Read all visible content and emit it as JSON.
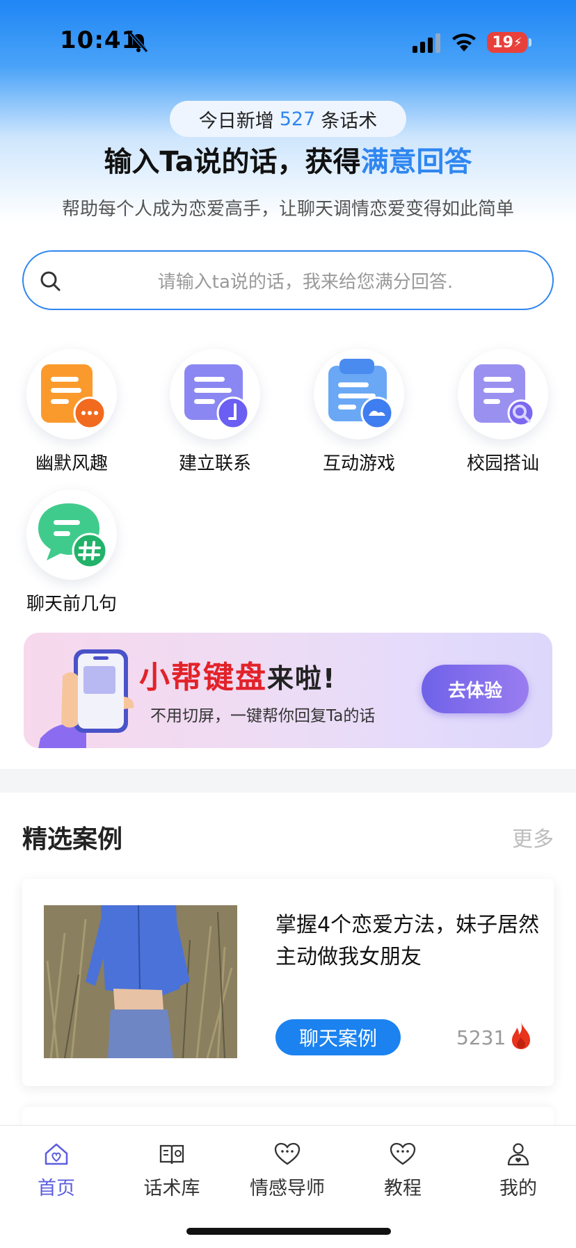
{
  "status_bar": {
    "time": "10:41",
    "battery": "19"
  },
  "header": {
    "daily_prefix": "今日新增",
    "daily_count": "527",
    "daily_suffix": "条话术",
    "title_part1": "输入Ta说的话，获得",
    "title_highlight": "满意回答",
    "subtitle": "帮助每个人成为恋爱高手，让聊天调情恋爱变得如此简单"
  },
  "search": {
    "placeholder": "请输入ta说的话，我来给您满分回答."
  },
  "categories": [
    {
      "label": "幽默风趣",
      "icon": "humor-icon"
    },
    {
      "label": "建立联系",
      "icon": "connect-icon"
    },
    {
      "label": "互动游戏",
      "icon": "game-icon"
    },
    {
      "label": "校园搭讪",
      "icon": "campus-icon"
    },
    {
      "label": "聊天前几句",
      "icon": "chat-opener-icon"
    }
  ],
  "banner": {
    "title_red": "小帮键盘",
    "title_dark": "来啦!",
    "subtitle": "不用切屏，一键帮你回复Ta的话",
    "button": "去体验"
  },
  "featured": {
    "title": "精选案例",
    "more": "更多",
    "cases": [
      {
        "title": "掌握4个恋爱方法，妹子居然主动做我女朋友",
        "tag": "聊天案例",
        "views": "5231"
      }
    ]
  },
  "tabbar": {
    "items": [
      {
        "label": "首页",
        "active": true
      },
      {
        "label": "话术库",
        "active": false
      },
      {
        "label": "情感导师",
        "active": false
      },
      {
        "label": "教程",
        "active": false
      },
      {
        "label": "我的",
        "active": false
      }
    ]
  },
  "colors": {
    "accent": "#2f86f0",
    "tab_active": "#5c5ce0",
    "banner_red": "#e22229",
    "fire": "#e8341c"
  }
}
